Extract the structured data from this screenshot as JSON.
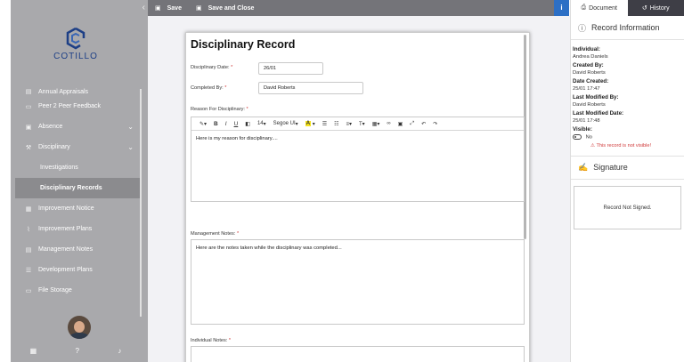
{
  "sidebar": {
    "logo_text": "COTILLO",
    "items": [
      {
        "label": "Annual Appraisals",
        "icon": "doc-icon"
      },
      {
        "label": "Peer 2 Peer Feedback",
        "icon": "comment-icon"
      },
      {
        "label": "Absence",
        "icon": "briefcase-icon"
      },
      {
        "label": "Disciplinary",
        "icon": "gavel-icon"
      },
      {
        "label": "Investigations"
      },
      {
        "label": "Disciplinary Records"
      },
      {
        "label": "Improvement Notice",
        "icon": "clipboard-icon"
      },
      {
        "label": "Improvement Plans",
        "icon": "chart-icon"
      },
      {
        "label": "Management Notes",
        "icon": "note-icon"
      },
      {
        "label": "Development Plans",
        "icon": "list-icon"
      },
      {
        "label": "File Storage",
        "icon": "drive-icon"
      }
    ]
  },
  "toolbar": {
    "save_label": "Save",
    "save_close_label": "Save and Close",
    "info_label": "i"
  },
  "form": {
    "title": "Disciplinary Record",
    "date_label": "Disciplinary Date:",
    "date_value": "26/01",
    "completed_by_label": "Completed By:",
    "completed_by_value": "David Roberts",
    "reason_label": "Reason For Disciplinary:",
    "reason_text": "Here is my reason for disciplinary....",
    "management_notes_label": "Management Notes:",
    "management_notes_text": "Here are the notes taken while the disciplinary was completed...",
    "individual_notes_label": "Individual Notes:",
    "required_mark": "*"
  },
  "editor_toolbar": {
    "font_size": "14",
    "font_family": "Segoe UI"
  },
  "right_panel": {
    "tab_document": "Document",
    "tab_history": "History",
    "record_info_title": "Record Information",
    "individual_label": "Individual:",
    "individual_value": "Andrea Daniels",
    "created_by_label": "Created By:",
    "created_by_value": "David Roberts",
    "date_created_label": "Date Created:",
    "date_created_value": "25/01 17:47",
    "last_modified_by_label": "Last Modified By:",
    "last_modified_by_value": "David Roberts",
    "last_modified_date_label": "Last Modified Date:",
    "last_modified_date_value": "25/01 17:48",
    "visible_label": "Visible:",
    "visible_value": "No",
    "warning": "This record is not visible!",
    "signature_title": "Signature",
    "signature_status": "Record Not Signed."
  },
  "colors": {
    "sidebar_bg": "#a9a9ac",
    "topbar_bg": "#747479",
    "info_blue": "#2c6fc5",
    "warning_red": "#d03b3b",
    "logo_blue": "#1d3f86"
  }
}
